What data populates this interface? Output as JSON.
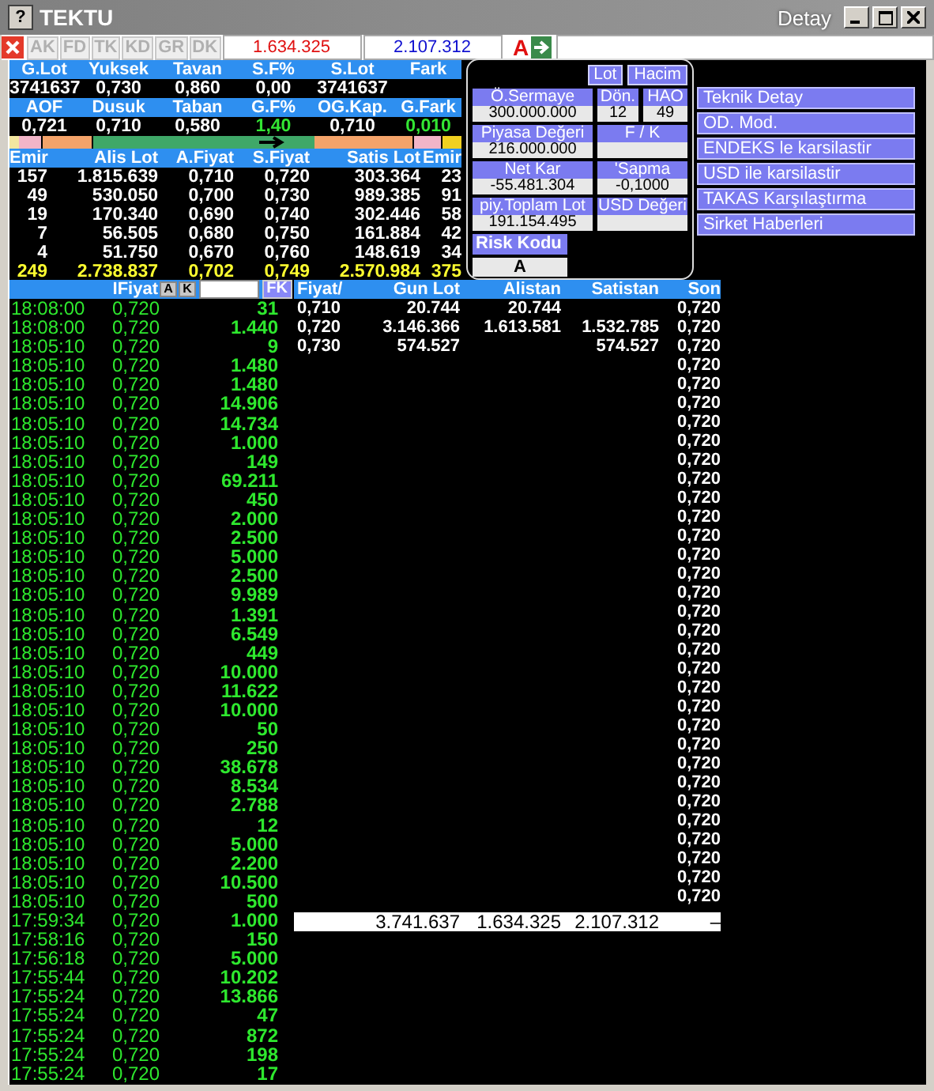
{
  "window": {
    "help": "?",
    "title": "TEKTU",
    "subtitle": "Detay"
  },
  "toolbar": {
    "tabs": [
      {
        "label": "AK",
        "disabled": true
      },
      {
        "label": "FD",
        "disabled": true
      },
      {
        "label": "TK",
        "disabled": true
      },
      {
        "label": "KD",
        "disabled": true
      },
      {
        "label": "GR",
        "disabled": true
      },
      {
        "label": "DK",
        "disabled": true
      }
    ],
    "buy_total": "1.634.325",
    "sell_total": "2.107.312",
    "marker": "A"
  },
  "quote": {
    "rows": [
      {
        "headers": [
          "G.Lot",
          "Yuksek",
          "Tavan",
          "S.F%",
          "S.Lot",
          "Fark"
        ],
        "values": [
          {
            "text": "3741637",
            "color": "#ffffff"
          },
          {
            "text": "0,730",
            "color": "#ffffff"
          },
          {
            "text": "0,860",
            "color": "#ffffff"
          },
          {
            "text": "0,00",
            "color": "#ffffff"
          },
          {
            "text": "3741637",
            "color": "#ffffff"
          }
        ]
      },
      {
        "headers": [
          "AOF",
          "Dusuk",
          "Taban",
          "G.F%",
          "OG.Kap.",
          "G.Fark"
        ],
        "values": [
          {
            "text": "0,721",
            "color": "#ffffff"
          },
          {
            "text": "0,710",
            "color": "#ffffff"
          },
          {
            "text": "0,580",
            "color": "#ffffff"
          },
          {
            "text": "1,40",
            "color": "#33e633"
          },
          {
            "text": "0,710",
            "color": "#ffffff"
          },
          {
            "text": "0,010",
            "color": "#33e633"
          }
        ]
      }
    ]
  },
  "depth": {
    "headers": [
      "Emir",
      "Alis Lot",
      "A.Fiyat",
      "S.Fiyat",
      "Satis Lot",
      "Emir"
    ],
    "rows": [
      [
        "157",
        "1.815.639",
        "0,710",
        "0,720",
        "303.364",
        "23"
      ],
      [
        "49",
        "530.050",
        "0,700",
        "0,730",
        "989.385",
        "91"
      ],
      [
        "19",
        "170.340",
        "0,690",
        "0,740",
        "302.446",
        "58"
      ],
      [
        "7",
        "56.505",
        "0,680",
        "0,750",
        "161.884",
        "42"
      ],
      [
        "4",
        "51.750",
        "0,670",
        "0,760",
        "148.619",
        "34"
      ]
    ],
    "totals": [
      "249",
      "2.738.837",
      "0,702",
      "0,749",
      "2.570.984",
      "375"
    ]
  },
  "info": {
    "buttons": [
      "Lot",
      "Hacim"
    ],
    "rows": [
      [
        {
          "label": "Ö.Sermaye",
          "value": "300.000.000"
        },
        {
          "label": "Dön.",
          "value": "12"
        },
        {
          "label": "HAO",
          "value": "49"
        }
      ],
      [
        {
          "label": "Piyasa Değeri",
          "value": "216.000.000"
        },
        {
          "label": "F / K"
        }
      ],
      [
        {
          "label": "Net Kar",
          "value": "-55.481.304"
        },
        {
          "label": "'Sapma",
          "value": "-0,1000"
        }
      ],
      [
        {
          "label": "piy.Toplam Lot",
          "value": "191.154.495"
        },
        {
          "label": "USD Değeri"
        }
      ]
    ],
    "risk": {
      "label": "Risk Kodu",
      "value": "A"
    }
  },
  "actions": [
    "Teknik Detay",
    "OD. Mod.",
    "ENDEKS le karsilastir",
    "USD ile karsilastir",
    "TAKAS Karşılaştırma",
    "Sirket Haberleri"
  ],
  "trades": {
    "header": "IFiyat",
    "buttons": [
      "A",
      "K"
    ],
    "filter_button": "FK",
    "rows": [
      {
        "time": "18:08:00",
        "price": "0,720",
        "lot": "31"
      },
      {
        "time": "18:08:00",
        "price": "0,720",
        "lot": "1.440"
      },
      {
        "time": "18:05:10",
        "price": "0,720",
        "lot": "9"
      },
      {
        "time": "18:05:10",
        "price": "0,720",
        "lot": "1.480"
      },
      {
        "time": "18:05:10",
        "price": "0,720",
        "lot": "1.480"
      },
      {
        "time": "18:05:10",
        "price": "0,720",
        "lot": "14.906"
      },
      {
        "time": "18:05:10",
        "price": "0,720",
        "lot": "14.734"
      },
      {
        "time": "18:05:10",
        "price": "0,720",
        "lot": "1.000"
      },
      {
        "time": "18:05:10",
        "price": "0,720",
        "lot": "149"
      },
      {
        "time": "18:05:10",
        "price": "0,720",
        "lot": "69.211"
      },
      {
        "time": "18:05:10",
        "price": "0,720",
        "lot": "450"
      },
      {
        "time": "18:05:10",
        "price": "0,720",
        "lot": "2.000"
      },
      {
        "time": "18:05:10",
        "price": "0,720",
        "lot": "2.500"
      },
      {
        "time": "18:05:10",
        "price": "0,720",
        "lot": "5.000"
      },
      {
        "time": "18:05:10",
        "price": "0,720",
        "lot": "2.500"
      },
      {
        "time": "18:05:10",
        "price": "0,720",
        "lot": "9.989"
      },
      {
        "time": "18:05:10",
        "price": "0,720",
        "lot": "1.391"
      },
      {
        "time": "18:05:10",
        "price": "0,720",
        "lot": "6.549"
      },
      {
        "time": "18:05:10",
        "price": "0,720",
        "lot": "449"
      },
      {
        "time": "18:05:10",
        "price": "0,720",
        "lot": "10.000"
      },
      {
        "time": "18:05:10",
        "price": "0,720",
        "lot": "11.622"
      },
      {
        "time": "18:05:10",
        "price": "0,720",
        "lot": "10.000"
      },
      {
        "time": "18:05:10",
        "price": "0,720",
        "lot": "50"
      },
      {
        "time": "18:05:10",
        "price": "0,720",
        "lot": "250"
      },
      {
        "time": "18:05:10",
        "price": "0,720",
        "lot": "38.678"
      },
      {
        "time": "18:05:10",
        "price": "0,720",
        "lot": "8.534"
      },
      {
        "time": "18:05:10",
        "price": "0,720",
        "lot": "2.788"
      },
      {
        "time": "18:05:10",
        "price": "0,720",
        "lot": "12"
      },
      {
        "time": "18:05:10",
        "price": "0,720",
        "lot": "5.000"
      },
      {
        "time": "18:05:10",
        "price": "0,720",
        "lot": "2.200"
      },
      {
        "time": "18:05:10",
        "price": "0,720",
        "lot": "10.500"
      },
      {
        "time": "18:05:10",
        "price": "0,720",
        "lot": "500"
      },
      {
        "time": "17:59:34",
        "price": "0,720",
        "lot": "1.000"
      },
      {
        "time": "17:58:16",
        "price": "0,720",
        "lot": "150"
      },
      {
        "time": "17:56:18",
        "price": "0,720",
        "lot": "5.000"
      },
      {
        "time": "17:55:44",
        "price": "0,720",
        "lot": "10.202"
      },
      {
        "time": "17:55:24",
        "price": "0,720",
        "lot": "13.866"
      },
      {
        "time": "17:55:24",
        "price": "0,720",
        "lot": "47"
      },
      {
        "time": "17:55:24",
        "price": "0,720",
        "lot": "872"
      },
      {
        "time": "17:55:24",
        "price": "0,720",
        "lot": "198"
      },
      {
        "time": "17:55:24",
        "price": "0,720",
        "lot": "17"
      }
    ]
  },
  "price_table": {
    "columns": [
      "Fiyat/",
      "Gun Lot",
      "Alistan",
      "Satistan",
      "Son"
    ],
    "rows": [
      {
        "fiyat": "0,710",
        "gun_lot": "20.744",
        "alistan": "20.744"
      },
      {
        "fiyat": "0,720",
        "gun_lot": "3.146.366",
        "alistan": "1.613.581",
        "satistan": "1.532.785"
      },
      {
        "fiyat": "0,730",
        "gun_lot": "574.527",
        "satistan": "574.527"
      }
    ],
    "son": [
      "0,720",
      "0,720",
      "0,720",
      "0,720",
      "0,720",
      "0,720",
      "0,720",
      "0,720",
      "0,720",
      "0,720",
      "0,720",
      "0,720",
      "0,720",
      "0,720",
      "0,720",
      "0,720",
      "0,720",
      "0,720",
      "0,720",
      "0,720",
      "0,720",
      "0,720",
      "0,720",
      "0,720",
      "0,720",
      "0,720",
      "0,720",
      "0,720",
      "0,720",
      "0,720",
      "0,720",
      "0,720"
    ],
    "totals": [
      "3.741.637",
      "1.634.325",
      "2.107.312",
      "–"
    ]
  }
}
